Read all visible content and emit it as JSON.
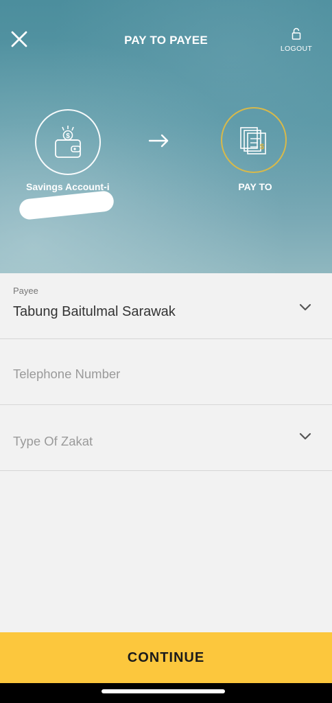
{
  "header": {
    "title": "PAY TO PAYEE",
    "logout_label": "LOGOUT",
    "close_icon": "close-icon",
    "lock_icon": "lock-icon"
  },
  "flow": {
    "from_label": "Savings Account-i",
    "from_icon": "wallet-icon",
    "to_label": "PAY TO",
    "to_icon": "bill-icon",
    "arrow_icon": "arrow-right-icon",
    "to_ring_color": "#d8b94a"
  },
  "form": {
    "payee": {
      "label": "Payee",
      "value": "Tabung Baitulmal Sarawak"
    },
    "telephone": {
      "placeholder": "Telephone Number"
    },
    "zakat_type": {
      "placeholder": "Type Of Zakat"
    }
  },
  "footer": {
    "continue_label": "CONTINUE",
    "accent_color": "#fcc73d"
  }
}
